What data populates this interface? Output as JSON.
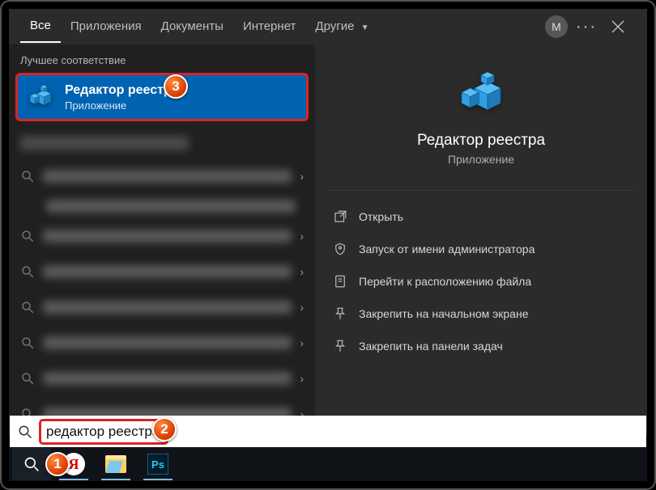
{
  "tabs": {
    "all": "Все",
    "apps": "Приложения",
    "docs": "Документы",
    "web": "Интернет",
    "other": "Другие"
  },
  "user_initial": "М",
  "left": {
    "best_match_label": "Лучшее соответствие",
    "result_title": "Редактор реестра",
    "result_subtitle": "Приложение"
  },
  "preview": {
    "title": "Редактор реестра",
    "subtitle": "Приложение"
  },
  "actions": {
    "open": "Открыть",
    "admin": "Запуск от имени администратора",
    "location": "Перейти к расположению файла",
    "pin_start": "Закрепить на начальном экране",
    "pin_taskbar": "Закрепить на панели задач"
  },
  "search": {
    "query": "редактор реестра"
  },
  "markers": {
    "m1": "1",
    "m2": "2",
    "m3": "3"
  },
  "yandex_letter": "Я",
  "ps_text": "Ps"
}
